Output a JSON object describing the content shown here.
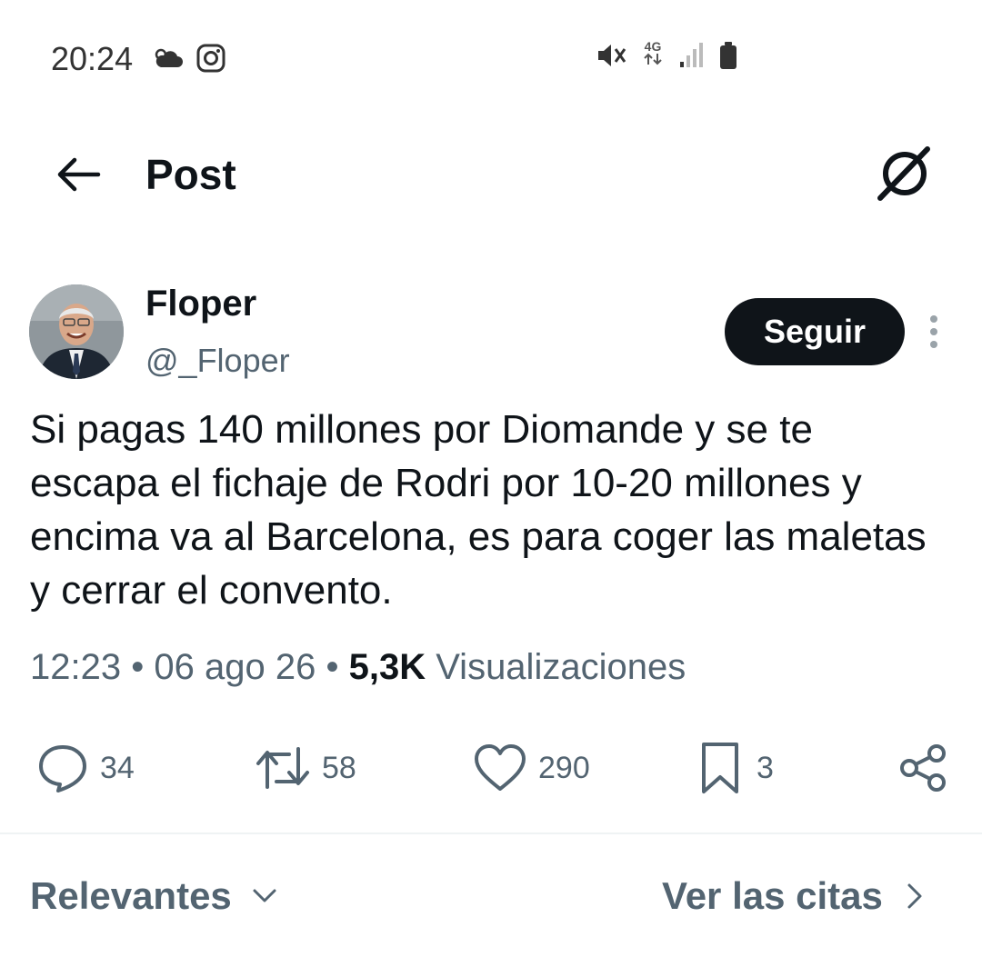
{
  "status_bar": {
    "time": "20:24",
    "network": "4G",
    "icons": [
      "cloud-icon",
      "instagram-icon",
      "mute-icon",
      "signal-icon",
      "battery-icon"
    ]
  },
  "header": {
    "title": "Post",
    "back_icon": "arrow-left-icon",
    "grok_icon": "grok-icon"
  },
  "author": {
    "display_name": "Floper",
    "handle": "@_Floper",
    "follow_label": "Seguir"
  },
  "tweet": {
    "text": "Si pagas 140 millones por Diomande y se te escapa el fichaje de Rodri por 10-20 millones y encima va al Barcelona, es para coger las maletas y cerrar el convento.",
    "time": "12:23",
    "date": "06 ago 26",
    "views_count": "5,3K",
    "views_label": "Visualizaciones"
  },
  "actions": {
    "replies": "34",
    "reposts": "58",
    "likes": "290",
    "bookmarks": "3"
  },
  "replies_bar": {
    "sort_label": "Relevantes",
    "quotes_label": "Ver las citas"
  },
  "colors": {
    "text": "#0f1419",
    "secondary": "#536471",
    "divider": "#eff3f4"
  }
}
